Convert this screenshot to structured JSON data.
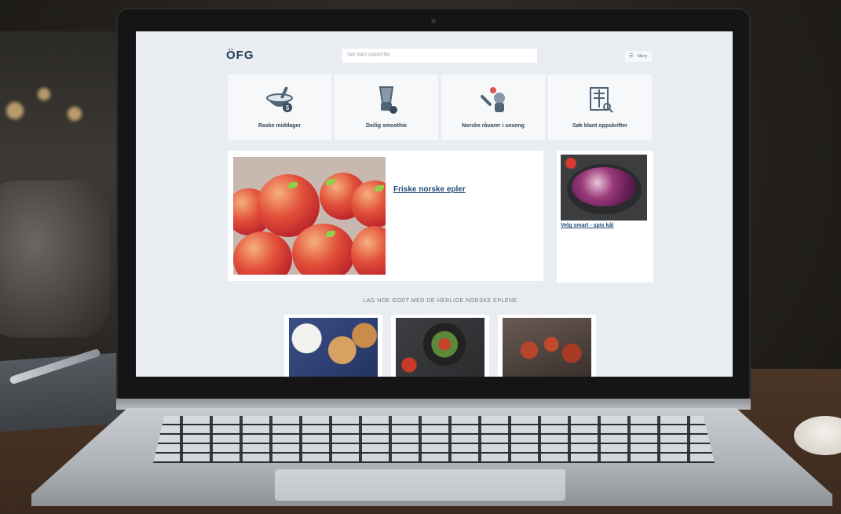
{
  "site": {
    "logo": "ÖFG",
    "logo_tagline": "",
    "search_placeholder": "Søk blant oppskrifter",
    "menu_label": "Meny"
  },
  "tiles": [
    {
      "label": "Raske middager",
      "icon": "mortar-bowl-icon"
    },
    {
      "label": "Deilig smoothie",
      "icon": "blender-icon"
    },
    {
      "label": "Norske råvarer i sesong",
      "icon": "vegetables-icon"
    },
    {
      "label": "Søk blant oppskrifter",
      "icon": "recipe-search-icon"
    }
  ],
  "feature": {
    "title": "Friske norske epler",
    "body": "",
    "body2": ""
  },
  "side_card": {
    "title": "Velg smart - spis kål",
    "body": ""
  },
  "section_heading": "LAG NOE GODT MED DE HERLIGE NORSKE EPLENE",
  "recipes": [
    {
      "name": "apple-pastry-photo"
    },
    {
      "name": "salad-bowl-photo"
    },
    {
      "name": "meatballs-photo"
    }
  ],
  "colors": {
    "brand": "#1f3d55",
    "link": "#1f4a78",
    "page_bg": "#e9edf1"
  }
}
